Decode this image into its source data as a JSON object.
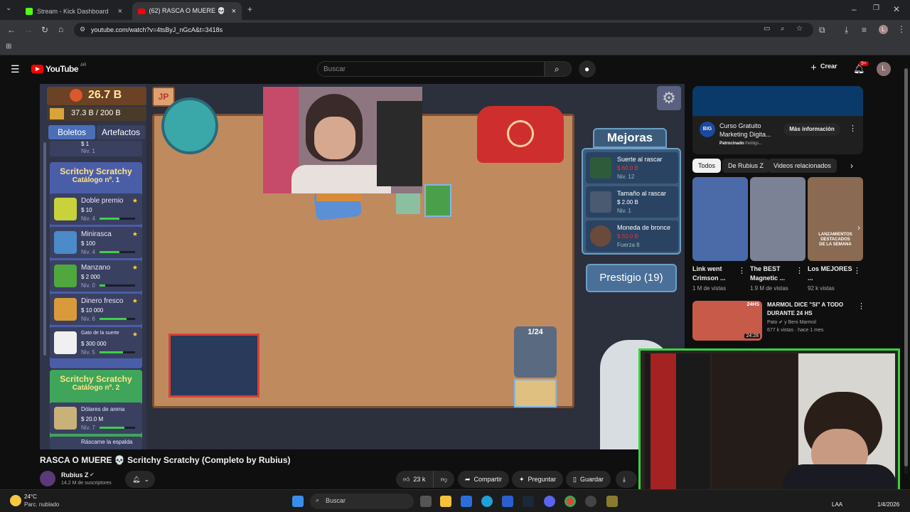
{
  "browser": {
    "tabs": [
      {
        "label": "Stream - Kick Dashboard"
      },
      {
        "label": "(62) RASCA O MUERE 💀 S"
      }
    ],
    "url": "youtube.com/watch?v=4tsByJ_nGcA&t=3418s"
  },
  "youtube": {
    "logo": "YouTube",
    "region": "AR",
    "search_placeholder": "Buscar",
    "create_label": "Crear",
    "notif_count": "9+",
    "avatar_initial": "L"
  },
  "game": {
    "money": "26.7 B",
    "capacity": "37.3 B / 200 B",
    "logo": "JP",
    "tabs": [
      "Boletos",
      "Artefactos"
    ],
    "top_partial": {
      "price": "$ 1",
      "level": "Niv. 1"
    },
    "catalog1_title": "Scritchy Scratchy",
    "catalog1_sub": "Catálogo nº. 1",
    "catalog2_title": "Scritchy Scratchy",
    "catalog2_sub": "Catálogo nº. 2",
    "tickets": [
      {
        "name": "Doble premio",
        "price": "$ 10",
        "level": "Niv. 4",
        "fill": 0.55,
        "icon_color": "#c8d23a"
      },
      {
        "name": "Minirasca",
        "price": "$ 100",
        "level": "Niv. 4",
        "fill": 0.55,
        "icon_color": "#4a8bc8"
      },
      {
        "name": "Manzano",
        "price": "$ 2 000",
        "level": "Niv. 0",
        "fill": 0.15,
        "icon_color": "#4fa73e"
      },
      {
        "name": "Dinero fresco",
        "price": "$ 10 000",
        "level": "Niv. 6",
        "fill": 0.75,
        "icon_color": "#d89a3a"
      },
      {
        "name": "Gato de la suerte",
        "price": "$ 300 000",
        "level": "Niv. 5",
        "fill": 0.65,
        "icon_color": "#f0f0f0"
      }
    ],
    "tickets2": [
      {
        "name": "Dólares de arena",
        "price": "$ 20.0 M",
        "level": "Niv. 7",
        "fill": 0.7
      },
      {
        "name": "Ráscame la espalda"
      }
    ],
    "counter": "1/24",
    "mejoras_title": "Mejoras",
    "mejoras": [
      {
        "name": "Suerte al rascar",
        "price": "$ 60.0 B",
        "level": "Niv. 12"
      },
      {
        "name": "Tamaño al rascar",
        "price": "$ 2.00 B",
        "level": "Niv. 1"
      },
      {
        "name": "Moneda de bronce",
        "price": "$ 50.0 B",
        "level": "Fuerza 8"
      }
    ],
    "prestige": "Prestigio (19)"
  },
  "ad": {
    "title": "Curso Gratuito Marketing Digita...",
    "sponsor": "Patrocinado",
    "sponsor_domain": "thebigs...",
    "button": "Más información",
    "badge": "BIG"
  },
  "chips": [
    "Todos",
    "De Rubius Z",
    "Videos relacionados"
  ],
  "shorts": [
    {
      "title": "Link went Crimson ...",
      "views": "1 M de vistas",
      "color": "#4b6aa8"
    },
    {
      "title": "The BEST Magnetic ...",
      "views": "1.9 M de vistas",
      "color": "#7b8296"
    },
    {
      "title": "Los MEJORES ...",
      "views": "92 k vistas",
      "color": "#8a6a52"
    }
  ],
  "shorts_overlay": [
    "LANZAMIENTOS",
    "DESTACADOS",
    "DE LA SEMANA"
  ],
  "related": {
    "title": "MARMOL DICE \"SI\" A TODO DURANTE 24 HS",
    "channel": "Pato",
    "channel_extra": "y Beni Marmol",
    "meta": "677 k vistas · hace 1 mes",
    "duration": "24:28",
    "thumb_label": "24HS"
  },
  "video": {
    "title": "RASCA O MUERE 💀 Scritchy Scratchy (Completo by Rubius)",
    "channel": "Rubius Z",
    "subs": "14.2 M de suscriptores",
    "likes": "23 k",
    "share": "Compartir",
    "ask": "Preguntar",
    "save": "Guardar"
  },
  "taskbar": {
    "temp": "24°C",
    "weather": "Parc. nublado",
    "search": "Buscar",
    "lang": "LAA",
    "date": "1/4/2026"
  }
}
